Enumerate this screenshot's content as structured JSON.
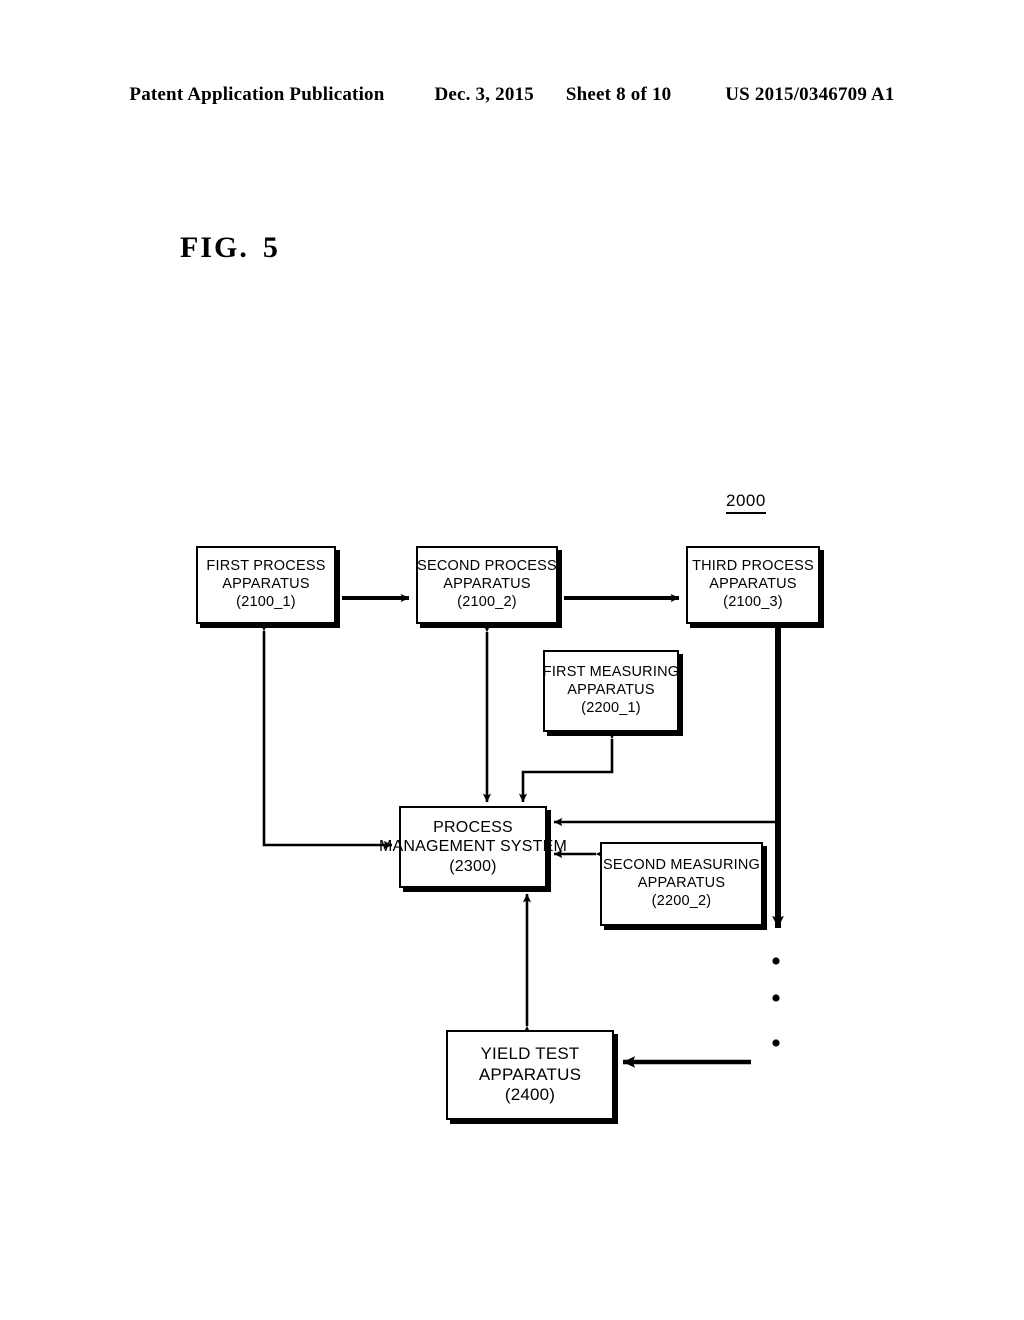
{
  "header": {
    "publication": "Patent Application Publication",
    "date": "Dec. 3, 2015",
    "sheet": "Sheet 8 of 10",
    "patent_number": "US 2015/0346709 A1"
  },
  "figure": {
    "label": "FIG.",
    "number": "5",
    "reference_numeral": "2000"
  },
  "nodes": {
    "first_process": {
      "line1": "FIRST PROCESS",
      "line2": "APPARATUS",
      "line3": "(2100_1)"
    },
    "second_process": {
      "line1": "SECOND PROCESS",
      "line2": "APPARATUS",
      "line3": "(2100_2)"
    },
    "third_process": {
      "line1": "THIRD PROCESS",
      "line2": "APPARATUS",
      "line3": "(2100_3)"
    },
    "first_measuring": {
      "line1": "FIRST MEASURING",
      "line2": "APPARATUS",
      "line3": "(2200_1)"
    },
    "process_management": {
      "line1": "PROCESS",
      "line2": "MANAGEMENT SYSTEM",
      "line3": "(2300)"
    },
    "second_measuring": {
      "line1": "SECOND MEASURING",
      "line2": "APPARATUS",
      "line3": "(2200_2)"
    },
    "yield_test": {
      "line1": "YIELD TEST",
      "line2": "APPARATUS",
      "line3": "(2400)"
    }
  },
  "connections": [
    {
      "name": "first-to-second-process",
      "style": "arrow-right"
    },
    {
      "name": "second-to-third-process",
      "style": "arrow-right"
    },
    {
      "name": "third-process-to-downstream",
      "style": "arrow-down-thick"
    },
    {
      "name": "first-process-to-management",
      "style": "bidirectional-elbow"
    },
    {
      "name": "second-process-to-management",
      "style": "bidirectional-vertical"
    },
    {
      "name": "first-measuring-to-management",
      "style": "bidirectional-elbow"
    },
    {
      "name": "second-measuring-to-management",
      "style": "bidirectional-horizontal"
    },
    {
      "name": "third-process-line-to-management",
      "style": "arrow-left"
    },
    {
      "name": "management-to-yield-test",
      "style": "bidirectional-vertical"
    },
    {
      "name": "downstream-to-yield-test",
      "style": "arrow-left"
    }
  ],
  "ellipsis": {
    "name": "vertical-ellipsis",
    "dots": 3
  },
  "colors": {
    "ink": "#000000",
    "paper": "#ffffff"
  }
}
